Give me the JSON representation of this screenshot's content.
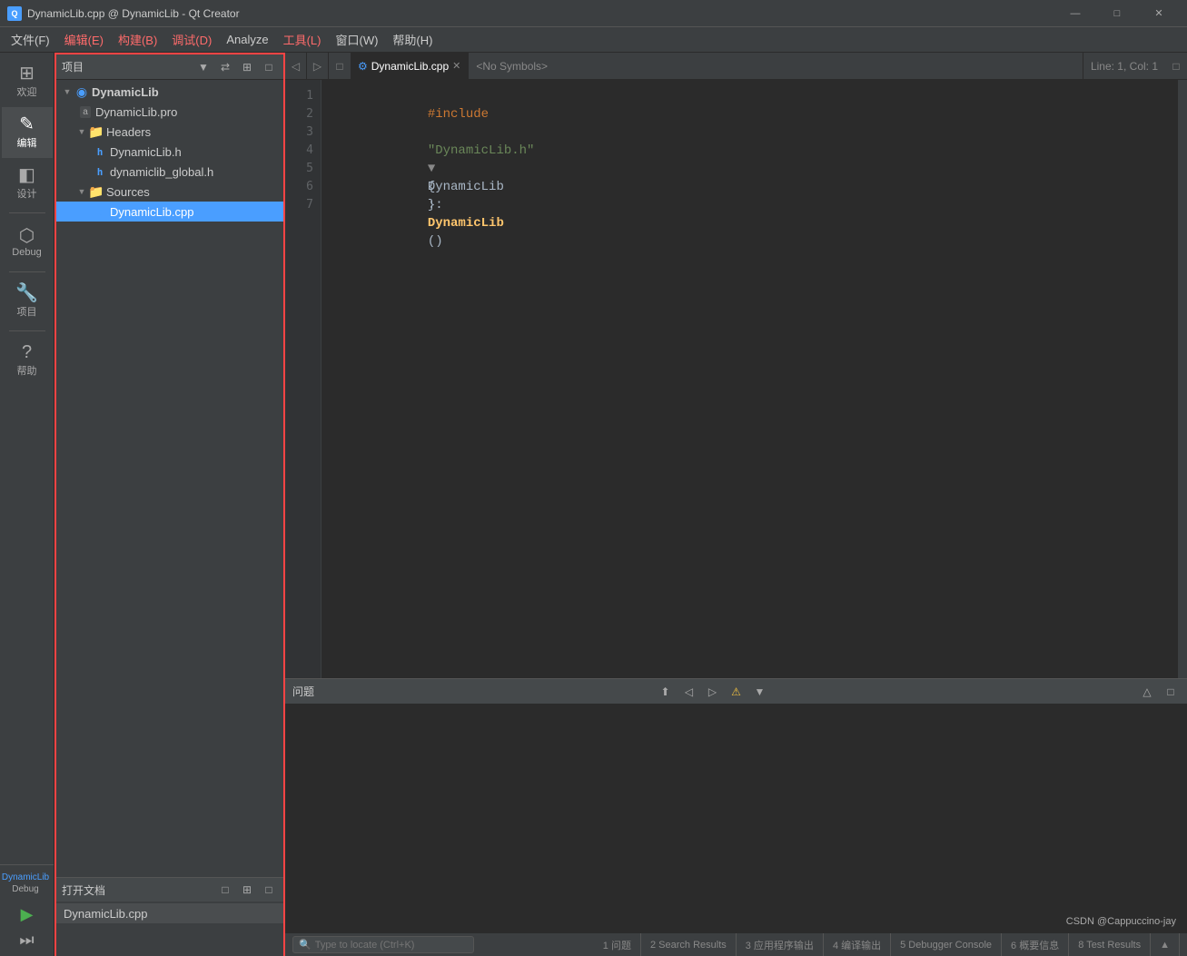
{
  "window": {
    "title": "DynamicLib.cpp @ DynamicLib - Qt Creator",
    "app_name": "Qt Creator"
  },
  "titlebar": {
    "title": "DynamicLib.cpp @ DynamicLib - Qt Creator",
    "minimize": "—",
    "maximize": "□",
    "close": "✕"
  },
  "menubar": {
    "items": [
      {
        "id": "file",
        "label": "文件(F)"
      },
      {
        "id": "edit",
        "label": "编辑(E)"
      },
      {
        "id": "build",
        "label": "构建(B)"
      },
      {
        "id": "debug",
        "label": "调试(D)"
      },
      {
        "id": "analyze",
        "label": "Analyze"
      },
      {
        "id": "tools",
        "label": "工具(L)"
      },
      {
        "id": "window",
        "label": "窗口(W)"
      },
      {
        "id": "help",
        "label": "帮助(H)"
      }
    ]
  },
  "left_sidebar": {
    "icons": [
      {
        "id": "welcome",
        "glyph": "⊞",
        "label": "欢迎"
      },
      {
        "id": "edit",
        "glyph": "✏",
        "label": "编辑"
      },
      {
        "id": "design",
        "glyph": "◧",
        "label": "设计"
      },
      {
        "id": "debug",
        "glyph": "🐛",
        "label": "Debug"
      },
      {
        "id": "projects",
        "glyph": "🔧",
        "label": "项目"
      },
      {
        "id": "help",
        "glyph": "?",
        "label": "帮助"
      }
    ]
  },
  "project_panel": {
    "title": "项目",
    "toolbar_buttons": [
      "⚙",
      "🔗",
      "⊞",
      "□"
    ],
    "tree": [
      {
        "id": "dynamiclib-root",
        "label": "DynamicLib",
        "level": 0,
        "type": "project",
        "expanded": true
      },
      {
        "id": "dynamiclib-pro",
        "label": "DynamicLib.pro",
        "level": 1,
        "type": "pro"
      },
      {
        "id": "headers-folder",
        "label": "Headers",
        "level": 1,
        "type": "folder-h",
        "expanded": true
      },
      {
        "id": "dynamiclib-h",
        "label": "DynamicLib.h",
        "level": 2,
        "type": "header"
      },
      {
        "id": "dynamiclib-global-h",
        "label": "dynamiclib_global.h",
        "level": 2,
        "type": "header"
      },
      {
        "id": "sources-folder",
        "label": "Sources",
        "level": 1,
        "type": "folder-s",
        "expanded": true
      },
      {
        "id": "dynamiclib-cpp",
        "label": "DynamicLib.cpp",
        "level": 2,
        "type": "cpp",
        "selected": true
      }
    ]
  },
  "open_docs_panel": {
    "title": "打开文档",
    "docs": [
      {
        "id": "dynamiclib-cpp-doc",
        "label": "DynamicLib.cpp"
      }
    ]
  },
  "editor": {
    "tabs": [
      {
        "id": "dynamiclib-cpp-tab",
        "label": "DynamicLib.cpp",
        "active": true
      },
      {
        "id": "symbols",
        "label": "<No Symbols>"
      }
    ],
    "line_col": "Line: 1, Col: 1",
    "code_lines": [
      {
        "num": 1,
        "content": "#include \"DynamicLib.h\"",
        "type": "include"
      },
      {
        "num": 2,
        "content": "",
        "type": "plain"
      },
      {
        "num": 3,
        "content": "",
        "type": "plain"
      },
      {
        "num": 4,
        "content": "DynamicLib::DynamicLib()",
        "type": "func",
        "foldable": true
      },
      {
        "num": 5,
        "content": "{",
        "type": "plain"
      },
      {
        "num": 6,
        "content": "}",
        "type": "plain"
      },
      {
        "num": 7,
        "content": "",
        "type": "plain"
      }
    ]
  },
  "bottom_panel": {
    "title": "问题",
    "toolbar_buttons": [
      "⬆",
      "⬇",
      "⚠",
      "▼"
    ]
  },
  "status_bar": {
    "search_placeholder": "Type to locate (Ctrl+K)",
    "tabs": [
      {
        "id": "issues",
        "label": "1 问题"
      },
      {
        "id": "search",
        "label": "2 Search Results"
      },
      {
        "id": "app-output",
        "label": "3 应用程序输出"
      },
      {
        "id": "compile",
        "label": "4 编译输出"
      },
      {
        "id": "debugger",
        "label": "5 Debugger Console"
      },
      {
        "id": "general",
        "label": "6 概要信息"
      },
      {
        "id": "test",
        "label": "8 Test Results"
      }
    ],
    "arrow": "▲"
  },
  "kit": {
    "name": "DynamicLib",
    "mode": "Debug"
  },
  "watermark": {
    "text": "CSDN @Cappuccino-jay"
  }
}
